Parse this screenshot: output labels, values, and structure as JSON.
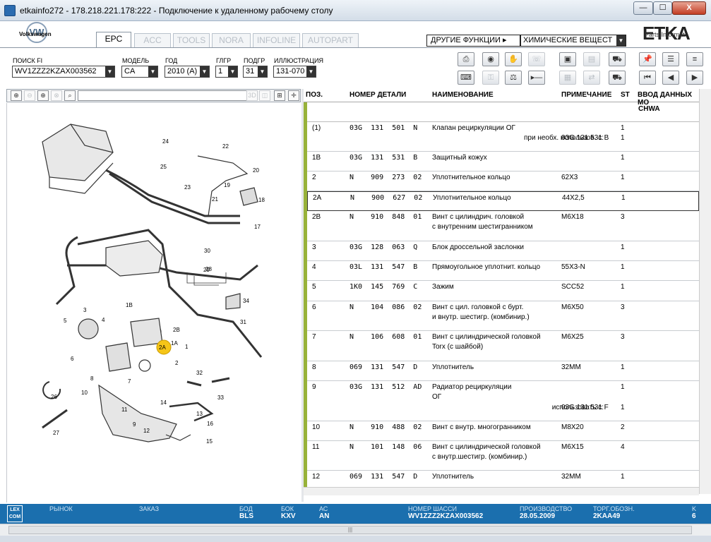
{
  "window": {
    "title": "etkainfo272 - 178.218.221.178:222 - Подключение к удаленному рабочему столу",
    "min_label": "—",
    "max_label": "☐",
    "close_label": "X"
  },
  "brand": {
    "vw_logo": "VW",
    "vw_text": "Volkswagen",
    "etka": "ETKA",
    "etka_sub": "Parts Informat"
  },
  "tabs": [
    {
      "label": "EPC"
    },
    {
      "label": "ACC"
    },
    {
      "label": "TOOLS"
    },
    {
      "label": "NORA"
    },
    {
      "label": "INFOLINE"
    },
    {
      "label": "AUTOPART"
    }
  ],
  "other_funcs": {
    "label": "ДРУГИЕ ФУНКЦИИ ▸",
    "selected": "ХИМИЧЕСКИЕ ВЕЩЕСТ"
  },
  "filters": {
    "search_label": "ПОИСК FI",
    "search_value": "WV1ZZZ2KZAX003562",
    "model_label": "МОДЕЛЬ",
    "model_value": "CA",
    "year_label": "ГОД",
    "year_value": "2010 (A)",
    "mg_label": "ГЛГР",
    "mg_value": "1",
    "sg_label": "ПОДГР",
    "sg_value": "31",
    "illus_label": "ИЛЛЮСТРАЦИЯ",
    "illus_value": "131-070"
  },
  "image_tools": {
    "3d": "3D"
  },
  "table": {
    "headers": {
      "pos": "ПОЗ.",
      "num": "НОМЕР ДЕТАЛИ",
      "name": "НАИМЕНОВАНИЕ",
      "note": "ПРИМЕЧАНИЕ",
      "st": "ST",
      "input": "ВВОД ДАННЫХ МО"
    },
    "subhead": "CHWA",
    "rows": [
      {
        "pos": "(1)",
        "num": "03G  131  501  N",
        "name": "Клапан рециркуляции ОГ",
        "note": "",
        "st": "1",
        "extra": [
          {
            "label": "при необх. использов. с:",
            "note": "03G 131 531 B",
            "st": "1"
          }
        ]
      },
      {
        "pos": "1B",
        "num": "03G  131  531  B",
        "name": "Защитный кожух",
        "note": "",
        "st": "1"
      },
      {
        "pos": "2",
        "num": "N    909  273  02",
        "name": "Уплотнительное кольцо",
        "note": "62X3",
        "st": "1"
      },
      {
        "pos": "2A",
        "num": "N    900  627  02",
        "name": "Уплотнительное кольцо",
        "note": "44X2,5",
        "st": "1"
      },
      {
        "pos": "2B",
        "num": "N    910  848  01",
        "name": "Винт с цилиндрич. головкой",
        "name2": "с внутренним шестигранником",
        "note": "M6X18",
        "st": "3"
      },
      {
        "pos": "3",
        "num": "03G  128  063  Q",
        "name": "Блок дроссельной заслонки",
        "note": "",
        "st": "1"
      },
      {
        "pos": "4",
        "num": "03L  131  547  B",
        "name": "Прямоугольное уплотнит. кольцо",
        "note": "55X3-N",
        "st": "1"
      },
      {
        "pos": "5",
        "num": "1K0  145  769  C",
        "name": "Зажим",
        "note": "SCC52",
        "st": "1"
      },
      {
        "pos": "6",
        "num": "N    104  086  02",
        "name": "Винт с цил. головкой с бурт.",
        "name2": "и внутр. шестигр. (комбинир.)",
        "note": "M6X50",
        "st": "3"
      },
      {
        "pos": "7",
        "num": "N    106  608  01",
        "name": "Винт с цилиндрической головкой",
        "name2": "Torx (с шайбой)",
        "note": "M6X25",
        "st": "3"
      },
      {
        "pos": "8",
        "num": "069  131  547  D",
        "name": "Уплотнитель",
        "note": "32MM",
        "st": "1"
      },
      {
        "pos": "9",
        "num": "03G  131  512  AD",
        "name": "Радиатор рециркуляции",
        "name2": "ОГ",
        "note": "",
        "st": "1",
        "extra": [
          {
            "label": "использовать с:",
            "note": "03G 131 531 F",
            "st": "1"
          }
        ]
      },
      {
        "pos": "10",
        "num": "N    910  488  02",
        "name": "Винт с внутр. многогранником",
        "note": "M8X20",
        "st": "2"
      },
      {
        "pos": "11",
        "num": "N    101  148  06",
        "name": "Винт с цилиндрической головкой",
        "name2": "с внутр.шестигр. (комбинир.)",
        "note": "M6X15",
        "st": "4"
      },
      {
        "pos": "12",
        "num": "069  131  547  D",
        "name": "Уплотнитель",
        "note": "32MM",
        "st": "1"
      }
    ]
  },
  "status": {
    "lexcom": "LEX COM",
    "market_label": "РЫНОК",
    "market_value": "",
    "order_label": "ЗАКАЗ",
    "order_value": "",
    "bod_label": "БОД",
    "bod_value": "BLS",
    "bok_label": "БОК",
    "bok_value": "KXV",
    "ac_label": "АС",
    "ac_value": "AN",
    "chassis_label": "НОМЕР ШАССИ",
    "chassis_value": "WV1ZZZ2KZAX003562",
    "prod_label": "ПРОИЗВОДСТВО",
    "prod_value": "28.05.2009",
    "trade_label": "ТОРГ.ОБОЗН.",
    "trade_value": "2KAA49",
    "k_label": "K",
    "k_value": "6"
  },
  "diagram_labels": [
    "1",
    "1A",
    "1B",
    "2",
    "2A",
    "2B",
    "3",
    "4",
    "5",
    "6",
    "7",
    "8",
    "9",
    "10",
    "11",
    "12",
    "13",
    "14",
    "15",
    "16",
    "17",
    "18",
    "19",
    "20",
    "21",
    "22",
    "23",
    "24",
    "25",
    "26",
    "27",
    "28",
    "29",
    "30",
    "31",
    "32",
    "33",
    "34"
  ],
  "colors": {
    "statusbar": "#1b6fae",
    "greenbar": "#98b23a",
    "highlight": "#f5c518"
  }
}
